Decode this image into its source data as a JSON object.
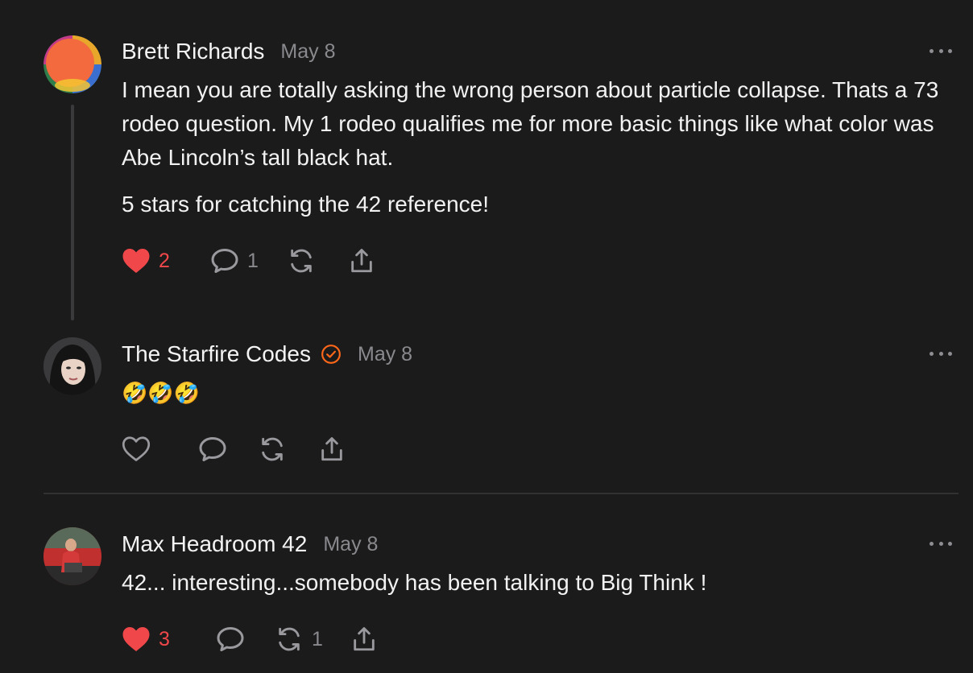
{
  "comments": [
    {
      "author": "Brett Richards",
      "date": "May 8",
      "paragraphs": [
        "I mean you are totally asking the wrong person about particle collapse. Thats a 73 rodeo question. My 1 rodeo qualifies me for more basic things like what color was Abe Lincoln’s tall black hat.",
        "5 stars for catching the 42 reference!"
      ],
      "likes": "2",
      "liked": true,
      "replies": "1",
      "restacks": ""
    },
    {
      "author": "The Starfire Codes",
      "verified": true,
      "date": "May 8",
      "paragraphs": [
        "🤣🤣🤣"
      ],
      "likes": "",
      "liked": false,
      "replies": "",
      "restacks": ""
    },
    {
      "author": "Max Headroom 42",
      "date": "May 8",
      "paragraphs": [
        "42... interesting...somebody has been talking to Big Think !"
      ],
      "likes": "3",
      "liked": true,
      "replies": "",
      "restacks": "1"
    }
  ],
  "colors": {
    "background": "#1b1b1c",
    "heart_active": "#f0474a",
    "verified_accent": "#ff6719",
    "muted": "#8a8a8e"
  },
  "icons": [
    "heart-icon",
    "comment-icon",
    "restack-icon",
    "share-icon",
    "more-icon",
    "verified-icon"
  ]
}
